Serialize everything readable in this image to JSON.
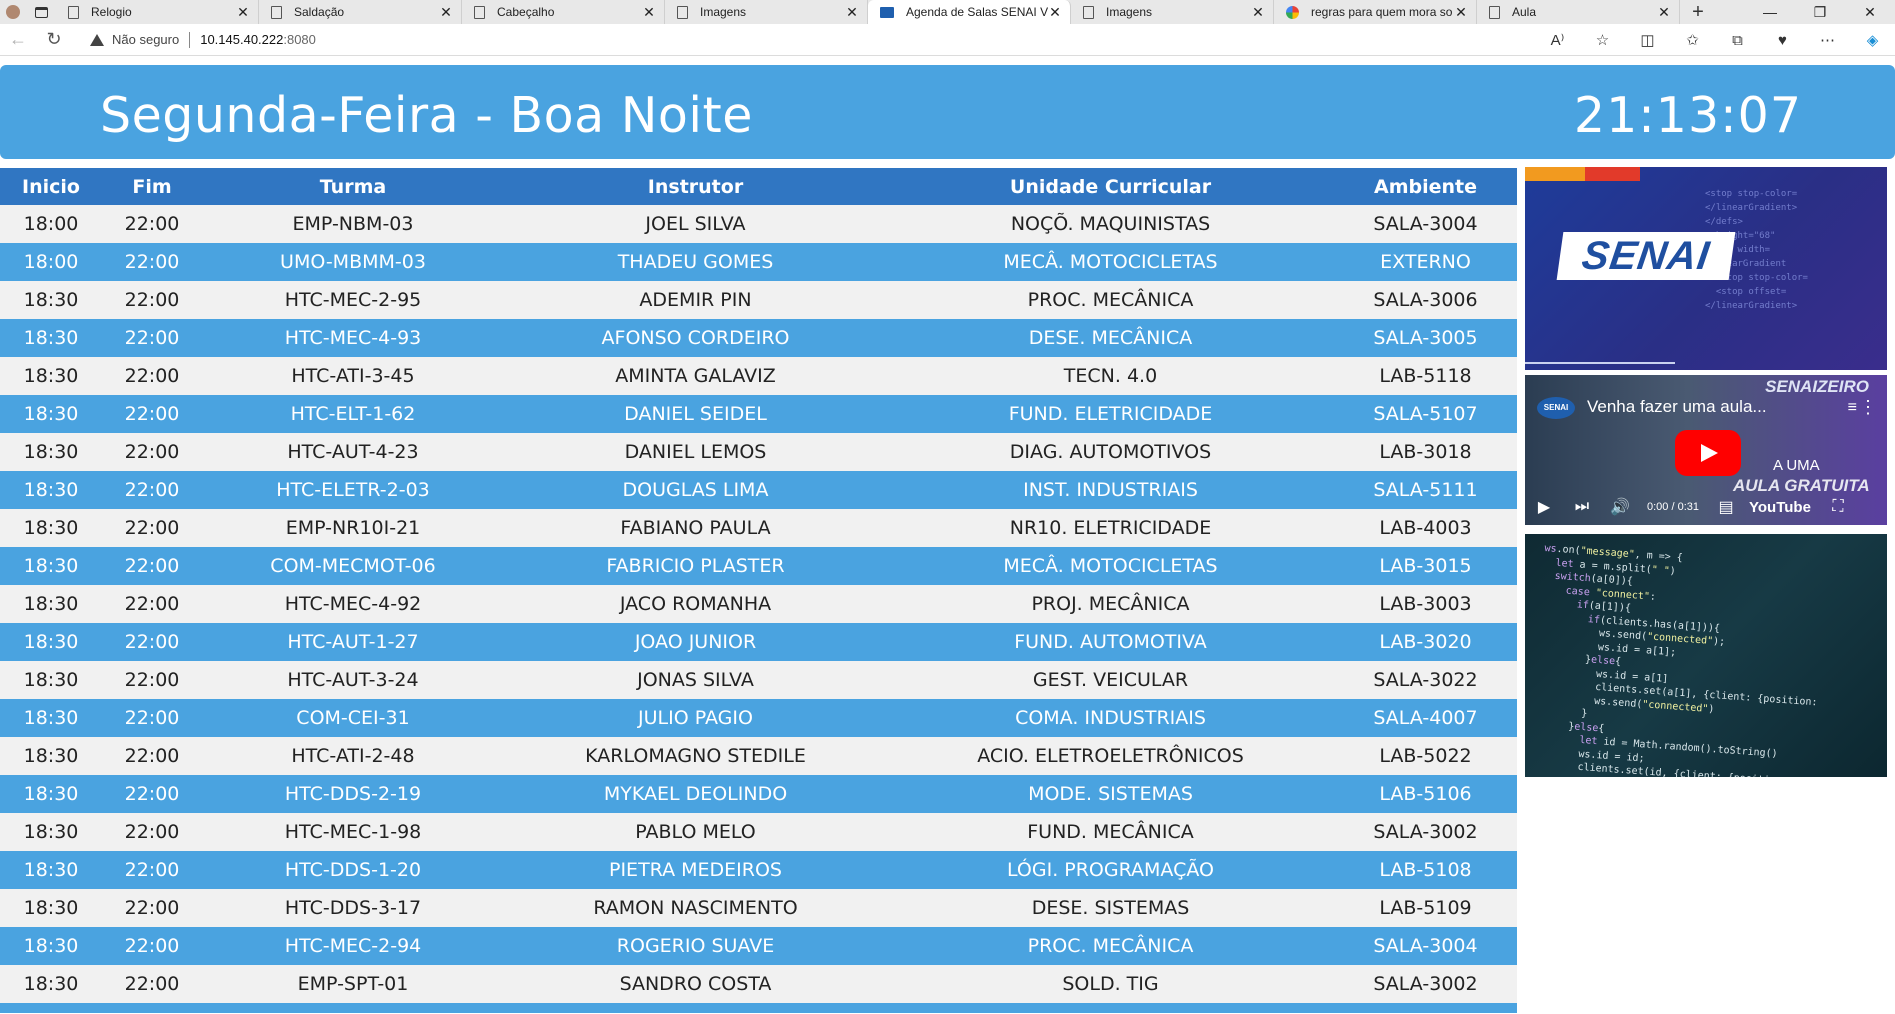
{
  "browser": {
    "tabs": [
      {
        "title": "Relogio",
        "icon": "page-icon"
      },
      {
        "title": "Saldação",
        "icon": "page-icon"
      },
      {
        "title": "Cabeçalho",
        "icon": "page-icon"
      },
      {
        "title": "Imagens",
        "icon": "page-icon"
      },
      {
        "title": "Agenda de Salas SENAI Vi",
        "icon": "senai-favicon",
        "active": true
      },
      {
        "title": "Imagens",
        "icon": "page-icon"
      },
      {
        "title": "regras para quem mora so",
        "icon": "google-icon"
      },
      {
        "title": "Aula",
        "icon": "page-icon"
      }
    ],
    "not_secure": "Não seguro",
    "url_host": "10.145.40.222",
    "url_port": ":8080"
  },
  "header": {
    "greeting": "Segunda-Feira - Boa Noite",
    "clock": "21:13:07"
  },
  "schedule": {
    "columns": [
      "Inicio",
      "Fim",
      "Turma",
      "Instrutor",
      "Unidade Curricular",
      "Ambiente"
    ],
    "rows": [
      [
        "18:00",
        "22:00",
        "EMP-NBM-03",
        "JOEL SILVA",
        "NOÇÕ. MAQUINISTAS",
        "SALA-3004"
      ],
      [
        "18:00",
        "22:00",
        "UMO-MBMM-03",
        "THADEU GOMES",
        "MECÂ. MOTOCICLETAS",
        "EXTERNO"
      ],
      [
        "18:30",
        "22:00",
        "HTC-MEC-2-95",
        "ADEMIR PIN",
        "PROC. MECÂNICA",
        "SALA-3006"
      ],
      [
        "18:30",
        "22:00",
        "HTC-MEC-4-93",
        "AFONSO CORDEIRO",
        "DESE. MECÂNICA",
        "SALA-3005"
      ],
      [
        "18:30",
        "22:00",
        "HTC-ATI-3-45",
        "AMINTA GALAVIZ",
        "TECN. 4.0",
        "LAB-5118"
      ],
      [
        "18:30",
        "22:00",
        "HTC-ELT-1-62",
        "DANIEL SEIDEL",
        "FUND. ELETRICIDADE",
        "SALA-5107"
      ],
      [
        "18:30",
        "22:00",
        "HTC-AUT-4-23",
        "DANIEL LEMOS",
        "DIAG. AUTOMOTIVOS",
        "LAB-3018"
      ],
      [
        "18:30",
        "22:00",
        "HTC-ELETR-2-03",
        "DOUGLAS LIMA",
        "INST. INDUSTRIAIS",
        "SALA-5111"
      ],
      [
        "18:30",
        "22:00",
        "EMP-NR10I-21",
        "FABIANO PAULA",
        "NR10. ELETRICIDADE",
        "LAB-4003"
      ],
      [
        "18:30",
        "22:00",
        "COM-MECMOT-06",
        "FABRICIO PLASTER",
        "MECÂ. MOTOCICLETAS",
        "LAB-3015"
      ],
      [
        "18:30",
        "22:00",
        "HTC-MEC-4-92",
        "JACO ROMANHA",
        "PROJ. MECÂNICA",
        "LAB-3003"
      ],
      [
        "18:30",
        "22:00",
        "HTC-AUT-1-27",
        "JOAO JUNIOR",
        "FUND. AUTOMOTIVA",
        "LAB-3020"
      ],
      [
        "18:30",
        "22:00",
        "HTC-AUT-3-24",
        "JONAS SILVA",
        "GEST. VEICULAR",
        "SALA-3022"
      ],
      [
        "18:30",
        "22:00",
        "COM-CEI-31",
        "JULIO PAGIO",
        "COMA. INDUSTRIAIS",
        "SALA-4007"
      ],
      [
        "18:30",
        "22:00",
        "HTC-ATI-2-48",
        "KARLOMAGNO STEDILE",
        "ACIO. ELETROELETRÔNICOS",
        "LAB-5022"
      ],
      [
        "18:30",
        "22:00",
        "HTC-DDS-2-19",
        "MYKAEL DEOLINDO",
        "MODE. SISTEMAS",
        "LAB-5106"
      ],
      [
        "18:30",
        "22:00",
        "HTC-MEC-1-98",
        "PABLO MELO",
        "FUND. MECÂNICA",
        "SALA-3002"
      ],
      [
        "18:30",
        "22:00",
        "HTC-DDS-1-20",
        "PIETRA MEDEIROS",
        "LÓGI. PROGRAMAÇÃO",
        "LAB-5108"
      ],
      [
        "18:30",
        "22:00",
        "HTC-DDS-3-17",
        "RAMON NASCIMENTO",
        "DESE. SISTEMAS",
        "LAB-5109"
      ],
      [
        "18:30",
        "22:00",
        "HTC-MEC-2-94",
        "ROGERIO SUAVE",
        "PROC. MECÂNICA",
        "SALA-3004"
      ],
      [
        "18:30",
        "22:00",
        "EMP-SPT-01",
        "SANDRO COSTA",
        "SOLD. TIG",
        "SALA-3002"
      ]
    ]
  },
  "side": {
    "banner_logo": "SENAI",
    "video": {
      "channel": "SENAI",
      "title": "Venha fazer uma aula...",
      "brand": "SENAIZEIRO",
      "promo_line1": "A UMA",
      "promo_line2": "AULA GRATUITA",
      "time": "0:00 / 0:31",
      "yt_logo": "YouTube"
    }
  },
  "colors": {
    "header_bg": "#4aa3e0",
    "table_head_bg": "#3076c2",
    "row_alt_bg": "#4aa3e0",
    "row_bg": "#f1f1f1"
  }
}
